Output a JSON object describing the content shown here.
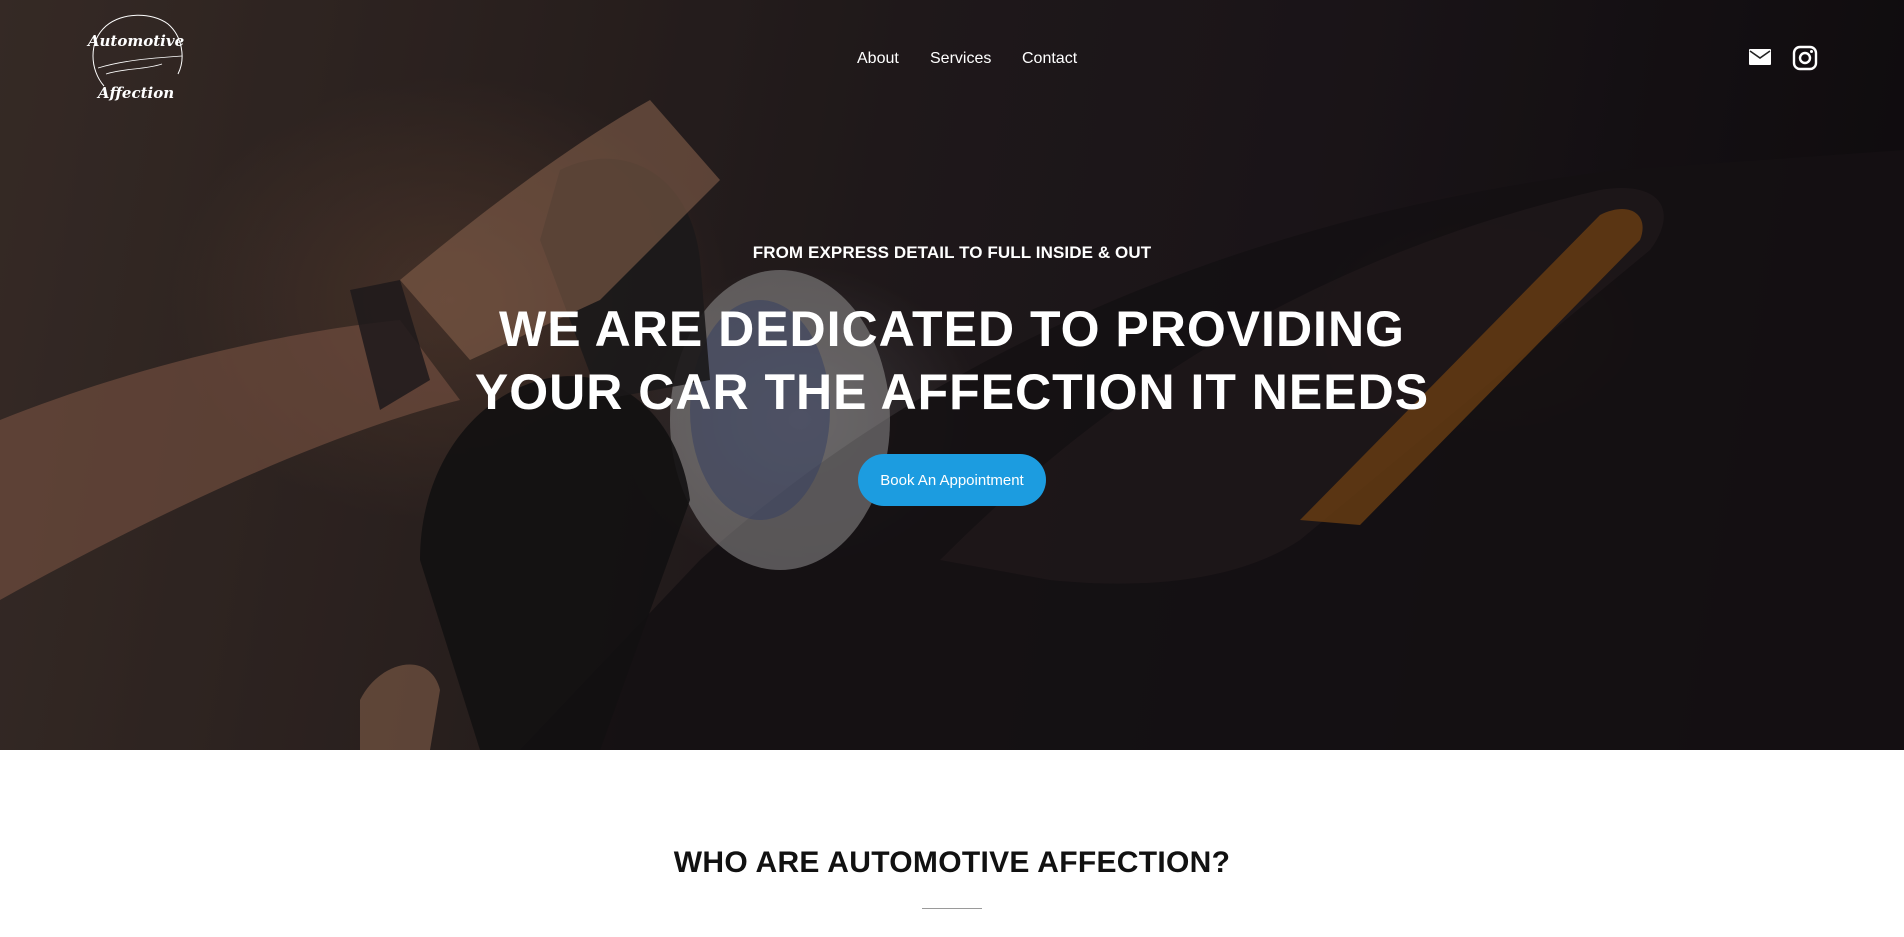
{
  "brand": {
    "logo_line1": "Automotive",
    "logo_line2": "Affection"
  },
  "nav": {
    "items": [
      "About",
      "Services",
      "Contact"
    ]
  },
  "social": {
    "icons": [
      "mail-icon",
      "instagram-icon"
    ]
  },
  "hero": {
    "kicker": "FROM EXPRESS DETAIL TO FULL INSIDE & OUT",
    "headline_line1": "WE ARE DEDICATED TO PROVIDING",
    "headline_line2": "YOUR CAR THE AFFECTION IT NEEDS",
    "cta_label": "Book An Appointment"
  },
  "about": {
    "title": "WHO ARE AUTOMOTIVE AFFECTION?",
    "partial_text": "· · · ·"
  },
  "colors": {
    "accent": "#1c9ce0",
    "hero_text": "#ffffff",
    "section_title": "#111111",
    "page_background": "#ffffff"
  }
}
